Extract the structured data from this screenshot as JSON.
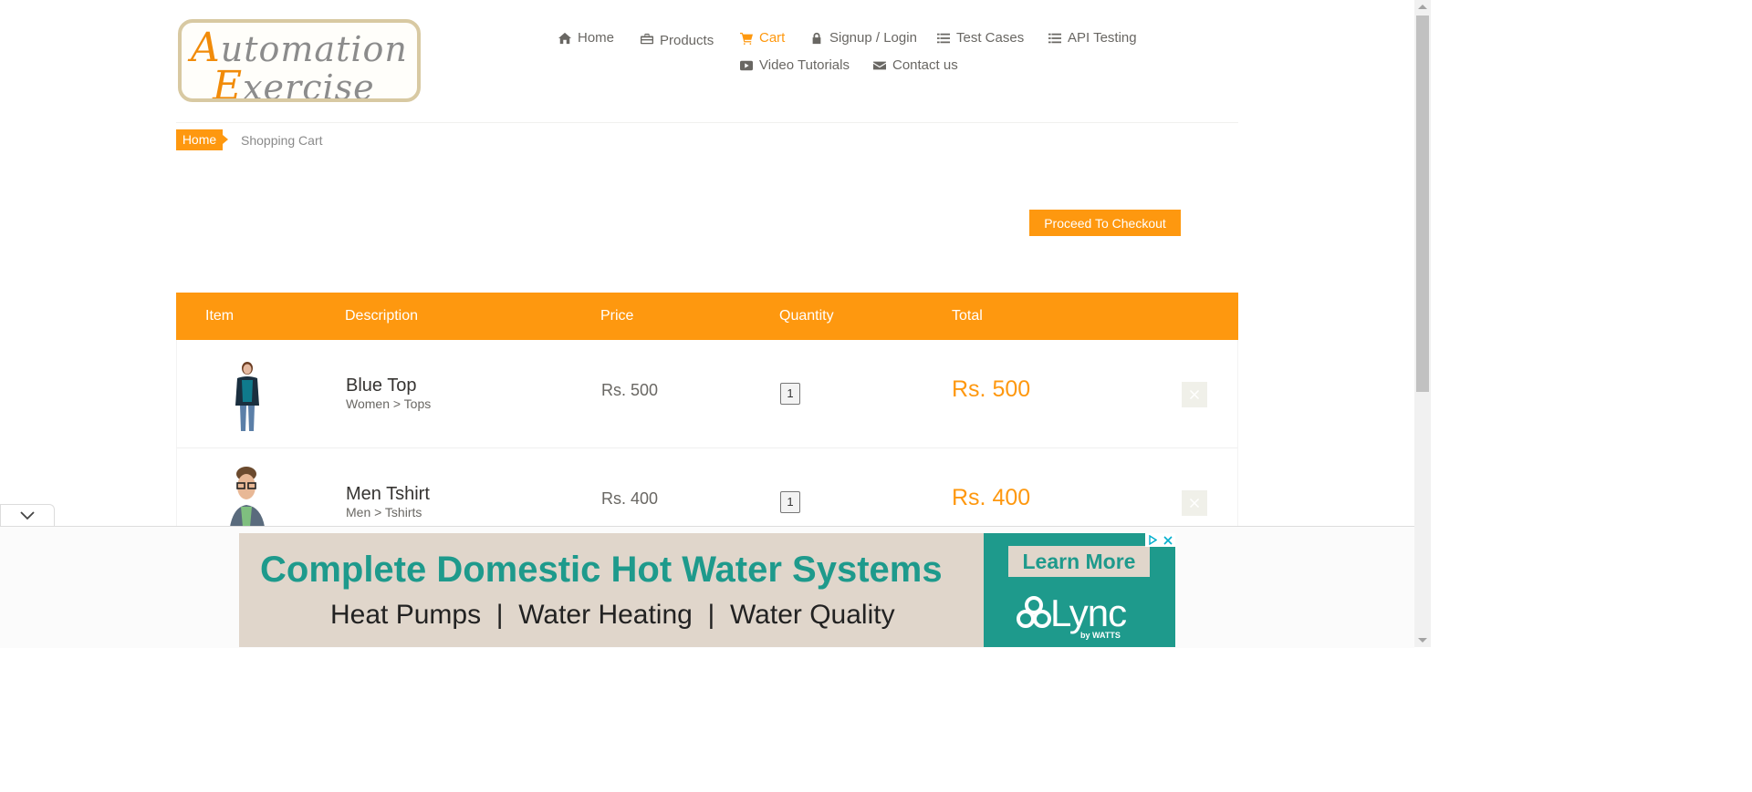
{
  "logo": {
    "line1_cap": "A",
    "line1_rest": "utomation",
    "line2_cap": "E",
    "line2_rest": "xercise"
  },
  "nav": [
    {
      "label": "Home",
      "icon": "home-icon"
    },
    {
      "label": "Products",
      "icon": "briefcase-icon"
    },
    {
      "label": "Cart",
      "icon": "cart-icon",
      "active": true
    },
    {
      "label": "Signup / Login",
      "icon": "lock-icon"
    },
    {
      "label": "Test Cases",
      "icon": "list-icon"
    },
    {
      "label": "API Testing",
      "icon": "list-icon"
    },
    {
      "label": "Video Tutorials",
      "icon": "youtube-icon"
    },
    {
      "label": "Contact us",
      "icon": "envelope-icon"
    }
  ],
  "breadcrumb": {
    "home": "Home",
    "current": "Shopping Cart"
  },
  "checkout_label": "Proceed To Checkout",
  "table": {
    "headers": [
      "Item",
      "Description",
      "Price",
      "Quantity",
      "Total"
    ],
    "rows": [
      {
        "name": "Blue Top",
        "category": "Women > Tops",
        "price": "Rs. 500",
        "quantity": "1",
        "total": "Rs. 500"
      },
      {
        "name": "Men Tshirt",
        "category": "Men > Tshirts",
        "price": "Rs. 400",
        "quantity": "1",
        "total": "Rs. 400"
      }
    ]
  },
  "ad": {
    "headline": "Complete Domestic Hot Water Systems",
    "subline": "Heat Pumps  |  Water Heating  |  Water Quality",
    "cta": "Learn More",
    "brand": "Lync",
    "brand_by": "by WATTS"
  },
  "colors": {
    "accent": "#fe980f",
    "ad_teal": "#1e9a8c"
  }
}
